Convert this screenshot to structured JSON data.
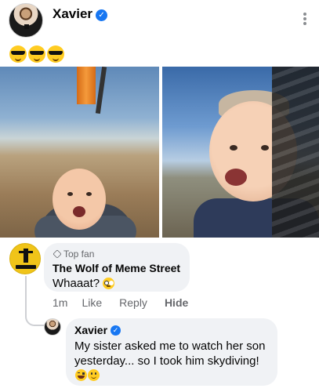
{
  "post": {
    "author": "Xavier",
    "caption_icons": [
      "sunglasses-face-icon",
      "sunglasses-face-icon",
      "sunglasses-face-icon"
    ],
    "photo_descriptions": [
      "baby skydiving with parachute",
      "baby skydiving close-up"
    ]
  },
  "comment": {
    "badge": "Top fan",
    "author": "The Wolf of Meme Street",
    "text": "Whaaat?",
    "emoji_icon": "flushed-face-icon",
    "actions": {
      "time": "1m",
      "like": "Like",
      "reply": "Reply",
      "hide": "Hide"
    }
  },
  "reply": {
    "author": "Xavier",
    "text": "My sister asked me to watch her son yesterday... so I took him skydiving!",
    "emoji_icons": [
      "laughing-face-icon",
      "smiling-face-icon"
    ]
  },
  "colors": {
    "verified_blue": "#1877f2",
    "bubble_bg": "#f0f2f5",
    "secondary_text": "#65676b"
  }
}
